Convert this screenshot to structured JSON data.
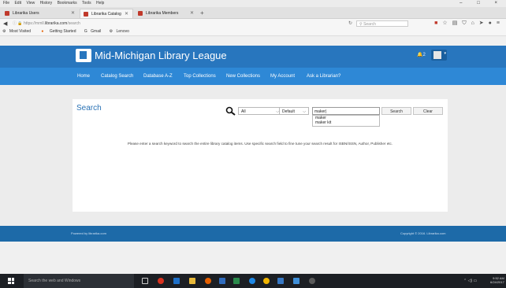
{
  "browser": {
    "menu": [
      "File",
      "Edit",
      "View",
      "History",
      "Bookmarks",
      "Tools",
      "Help"
    ],
    "window_controls": [
      "–",
      "□",
      "×"
    ],
    "tabs": [
      {
        "label": "Librarika Users",
        "active": false
      },
      {
        "label": "Librarika Catalog Search",
        "active": true
      },
      {
        "label": "Librarika Members",
        "active": false
      }
    ],
    "new_tab": "+",
    "url_prefix": "https://mmll.",
    "url_domain": "librarika.com",
    "url_path": "/search",
    "search_placeholder": "Search",
    "bookmarks": [
      "Most Visited",
      "Getting Started",
      "Gmail",
      "Lenovo"
    ]
  },
  "site": {
    "title": "Mid-Michigan Library League",
    "notification_count": "2",
    "nav": [
      "Home",
      "Catalog Search",
      "Database A-Z",
      "Top Collections",
      "New Collections",
      "My Account",
      "Ask a Librarian?"
    ]
  },
  "search": {
    "heading": "Search",
    "field_value": "All",
    "sort_value": "Default",
    "keyword": "maker|",
    "suggestions": [
      "maker",
      "maker kit"
    ],
    "search_button": "Search",
    "clear_button": "Clear",
    "help": "Please enter a search keyword to search the entire library catalog items. Use specific search field to fine tune your search result for ISBN/ISSN, Author, Publisher etc."
  },
  "footer": {
    "powered_by": "Powered by librarika.com",
    "copyright": "Copyright © 2016. Librarika.com"
  },
  "taskbar": {
    "search_placeholder": "Search the web and Windows",
    "time": "9:52 AM",
    "date": "6/24/2017"
  },
  "colors": {
    "header_blue": "#2876be",
    "nav_blue": "#2e88d6",
    "footer_blue": "#1d6aa8",
    "accent_text": "#2a72b5"
  }
}
